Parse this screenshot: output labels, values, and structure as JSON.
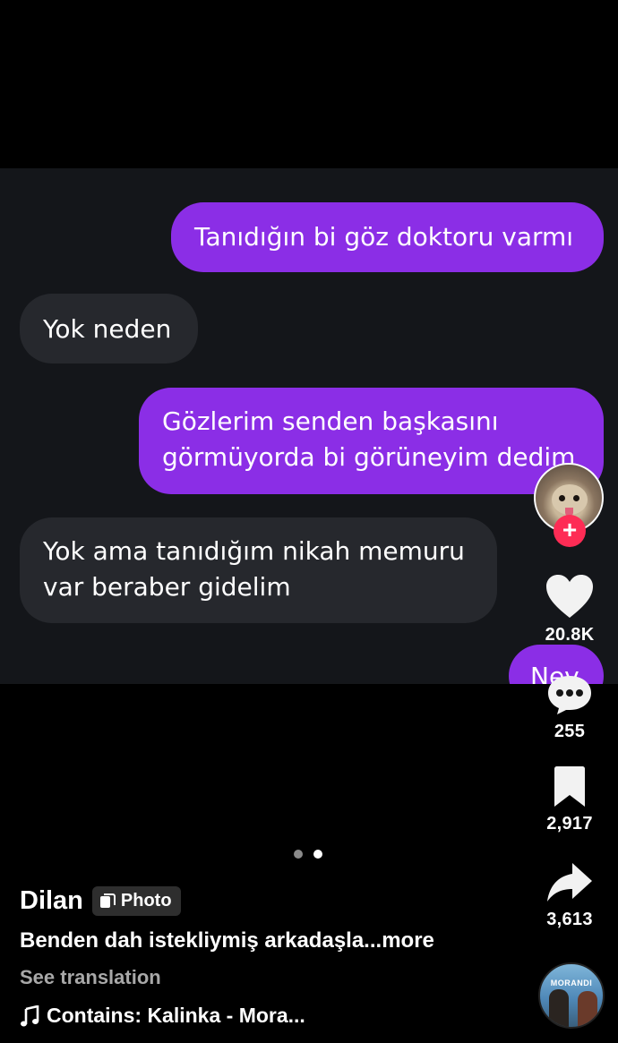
{
  "messages": {
    "m1": "Tanıdığın bi göz doktoru varmı",
    "m2": "Yok neden",
    "m3": "Gözlerim senden başkasını\ngörmüyorda bi görüneyim dedim",
    "m4": "Yok ama tanıdığım nikah memuru\nvar beraber gidelim",
    "m5": "Nev"
  },
  "actions": {
    "likes": "20.8K",
    "comments": "255",
    "saves": "2,917",
    "shares": "3,613"
  },
  "post": {
    "author": "Dilan",
    "badge": "Photo",
    "caption": "Benden dah istekliymiş arkadaşla...",
    "more": "more",
    "see_translation": "See translation",
    "music": "Contains: Kalinka - Mora..."
  },
  "music_disc_label": "MORANDI",
  "colors": {
    "sent_bubble": "#8b2ee6",
    "received_bubble": "#26282d",
    "follow_button": "#fe2c55"
  }
}
